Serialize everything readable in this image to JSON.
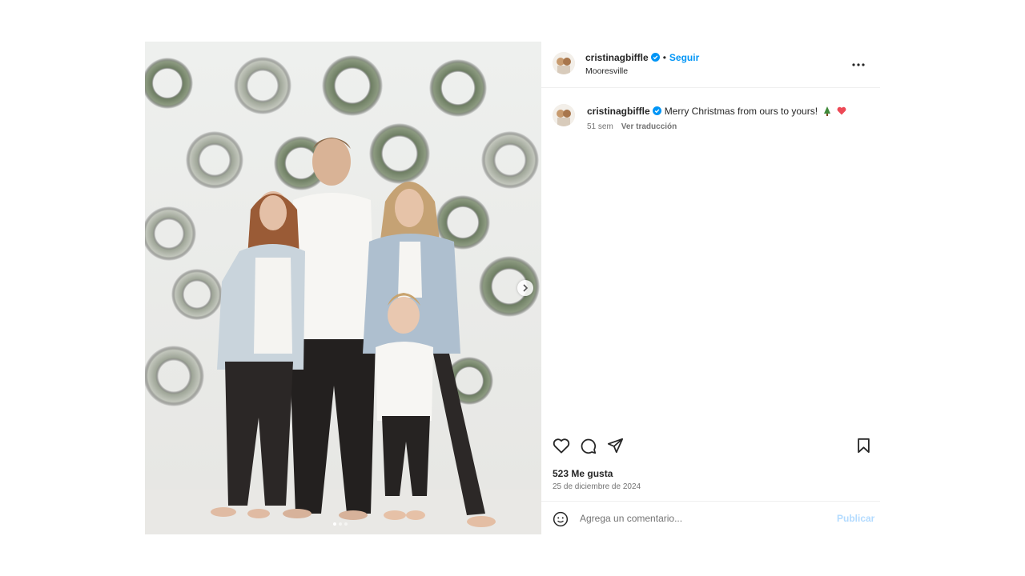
{
  "post": {
    "username": "cristinagbiffle",
    "follow_label": "Seguir",
    "bullet": "•",
    "location": "Mooresville",
    "more_label": "•••",
    "caption_text": "Merry Christmas from ours to yours!",
    "caption_emojis": [
      "christmas-tree",
      "heart"
    ],
    "time_ago": "51 sem",
    "translate_label": "Ver traducción",
    "likes": "523 Me gusta",
    "date": "25 de diciembre de 2024",
    "comment_placeholder": "Agrega un comentario...",
    "publish_label": "Publicar"
  },
  "carousel": {
    "current": 1,
    "total": 3
  },
  "colors": {
    "accent": "#0095f6",
    "publish_disabled": "#b3dbff",
    "verified": "#0095f6",
    "heart": "#ed4956"
  },
  "icons": [
    "verified-badge-icon",
    "more-options-icon",
    "heart-icon",
    "comment-icon",
    "share-icon",
    "bookmark-icon",
    "emoji-icon",
    "chevron-right-icon"
  ]
}
